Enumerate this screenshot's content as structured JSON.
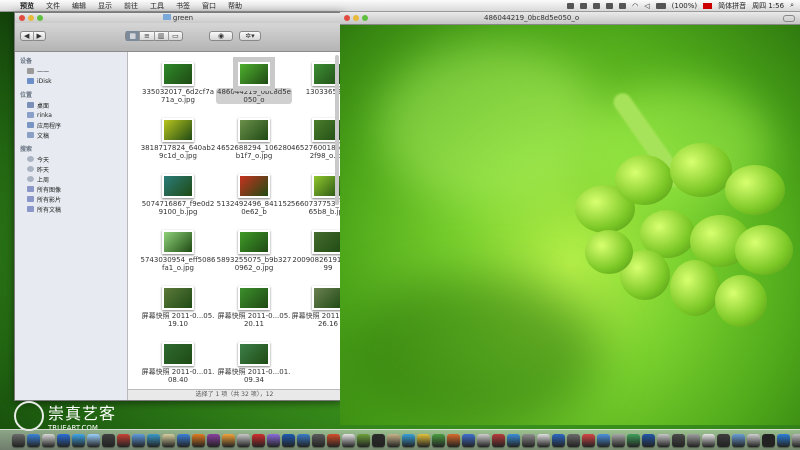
{
  "menubar": {
    "items": [
      "预览",
      "文件",
      "编辑",
      "显示",
      "前往",
      "工具",
      "书签",
      "窗口",
      "帮助"
    ],
    "battery": "(100%)",
    "input_method": "简体拼音",
    "user": "rinka",
    "time": "周四 1:56"
  },
  "finder": {
    "title": "green",
    "sidebar": {
      "devices_label": "设备",
      "devices": [
        "——",
        "iDisk"
      ],
      "places_label": "位置",
      "places": [
        "桌面",
        "rinka",
        "应用程序",
        "文稿"
      ],
      "search_label": "搜索",
      "search": [
        "今天",
        "昨天",
        "上周",
        "所有图像",
        "所有影片",
        "所有文稿"
      ]
    },
    "files": [
      {
        "name": "335032017_6d2cf7a71a_o.jpg",
        "color": "#2f8a2a"
      },
      {
        "name": "486044219_0bc8d5e050_o",
        "color": "#4fb02e",
        "selected": true
      },
      {
        "name": "1303365271",
        "color": "#3d8e35"
      },
      {
        "name": "3818717824_640ab29c1d_o.jpg",
        "color": "#b8c51e"
      },
      {
        "name": "4652688294_106280b1f7_o.jpg",
        "color": "#6b8f4a"
      },
      {
        "name": "4652760018_e807c02f98_o.jpg",
        "color": "#4a7d2a"
      },
      {
        "name": "5074716867_f9e0d29100_b.jpg",
        "color": "#2b7c7a"
      },
      {
        "name": "5132492496_8411520e62_b",
        "color": "#c6321f"
      },
      {
        "name": "5660737753_724c7765b8_b.jpg",
        "color": "#8fc62c"
      },
      {
        "name": "5743030954_eff5086fa1_o.jpg",
        "color": "#8fd27a"
      },
      {
        "name": "5893255075_b9b3270962_o.jpg",
        "color": "#3e9a27"
      },
      {
        "name": "2009082619192173 99",
        "color": "#466c2e"
      },
      {
        "name": "屏幕快照 2011-0...05.19.10",
        "color": "#5c7a3a"
      },
      {
        "name": "屏幕快照 2011-0...05.20.11",
        "color": "#3c8f2c"
      },
      {
        "name": "屏幕快照 2011-0...05.26.16",
        "color": "#6a8050"
      },
      {
        "name": "屏幕快照 2011-0...01.08.40",
        "color": "#2e6a30"
      },
      {
        "name": "屏幕快照 2011-0...01.09.34",
        "color": "#3d7f48"
      }
    ],
    "status": "选择了 1 项（共 32 项），12"
  },
  "preview": {
    "title": "486044219_0bc8d5e050_o"
  },
  "watermark": {
    "name": "崇真艺客",
    "site": "TRUEART.COM"
  },
  "dock_colors": [
    "#6a6a6a",
    "#3b84d9",
    "#d9d9d9",
    "#2a6fd8",
    "#3ea6e8",
    "#9bd1ff",
    "#3f3f3f",
    "#c94236",
    "#5e9be0",
    "#3a9ac9",
    "#d8d0a0",
    "#3c7fd8",
    "#e07b20",
    "#8a3fa0",
    "#f2a33b",
    "#c9c9c9",
    "#d12d2d",
    "#8b6cdb",
    "#1e5ab0",
    "#3a7bc8",
    "#5b5b5b",
    "#d34e2a",
    "#e5e5e5",
    "#6fa13a",
    "#2b2b2b",
    "#c9b48a",
    "#38a0d8",
    "#e2c23a",
    "#4a9d3f",
    "#d86a2a",
    "#3f6fd0",
    "#cfcfcf",
    "#b83b3b",
    "#3a8fd8",
    "#8f8f8f",
    "#e0e0e0",
    "#2c68c2",
    "#6b6b6b",
    "#d64545",
    "#4c93df",
    "#a7a7a7",
    "#3fa05a",
    "#2257a8",
    "#c8c8c8",
    "#4a4a4a",
    "#9f9f9f",
    "#e8e8e8",
    "#3d3d3d",
    "#6a9fd8",
    "#d0d0d0",
    "#222222",
    "#2d7fd8",
    "#bdbdbd",
    "#535353"
  ]
}
